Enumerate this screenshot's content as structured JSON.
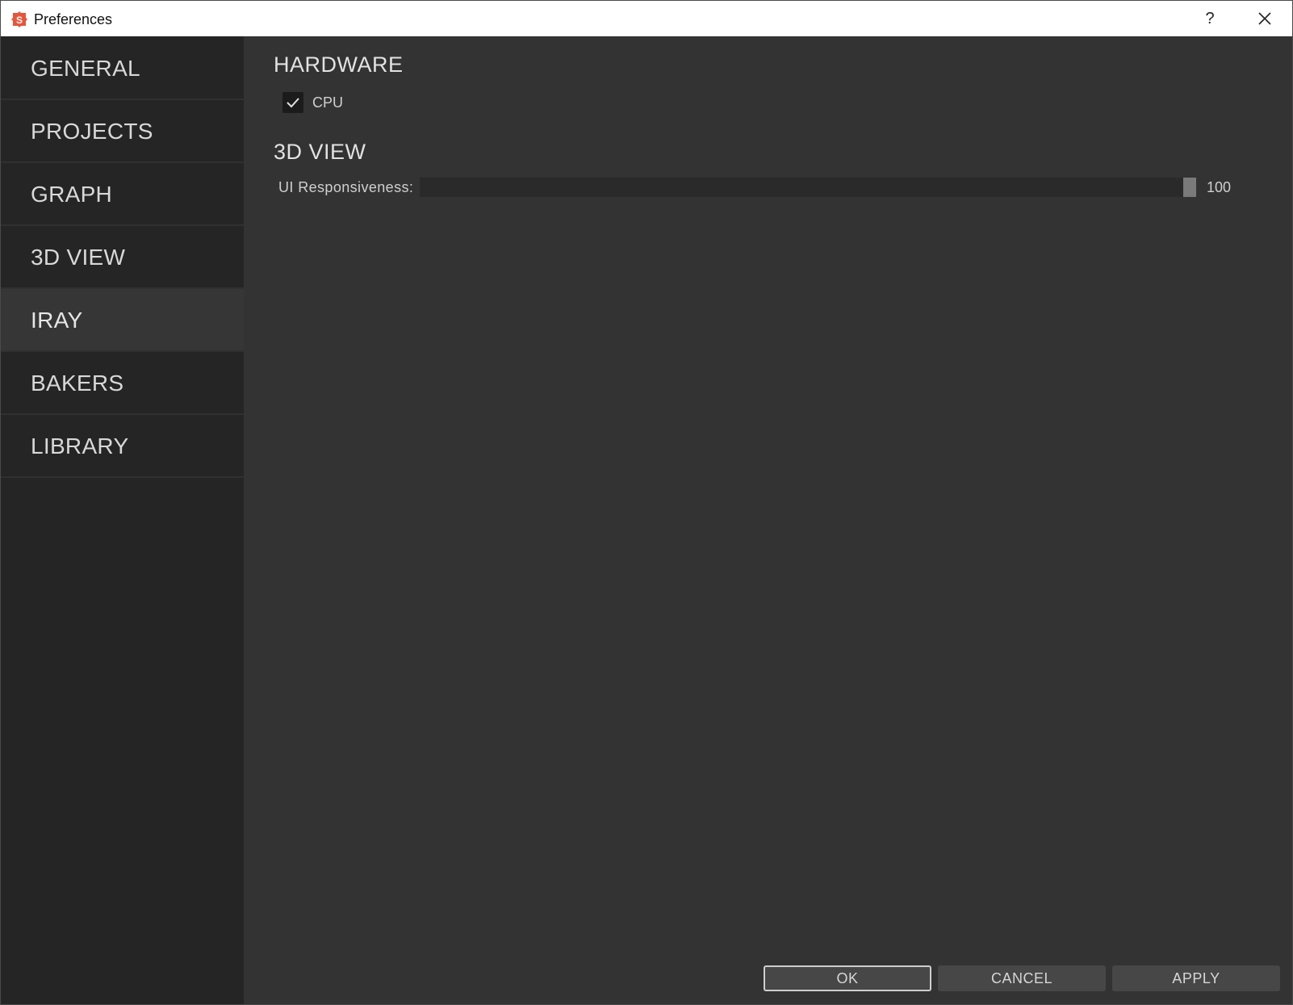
{
  "window": {
    "title": "Preferences",
    "help_label": "?"
  },
  "sidebar": {
    "items": [
      {
        "label": "GENERAL",
        "active": false
      },
      {
        "label": "PROJECTS",
        "active": false
      },
      {
        "label": "GRAPH",
        "active": false
      },
      {
        "label": "3D VIEW",
        "active": false
      },
      {
        "label": "IRAY",
        "active": true
      },
      {
        "label": "BAKERS",
        "active": false
      },
      {
        "label": "LIBRARY",
        "active": false
      }
    ]
  },
  "main": {
    "hardware": {
      "title": "HARDWARE",
      "cpu_label": "CPU",
      "cpu_checked": true
    },
    "view3d": {
      "title": "3D VIEW",
      "responsiveness_label": "UI Responsiveness:",
      "responsiveness_value": "100",
      "responsiveness_fraction": 1.0
    }
  },
  "buttons": {
    "ok": "OK",
    "cancel": "CANCEL",
    "apply": "APPLY"
  },
  "colors": {
    "app_icon": "#e8543a",
    "accent_handle": "#7a7a7a"
  },
  "icons": {
    "app": "substance-logo-icon",
    "close": "close-icon",
    "check": "checkmark-icon"
  }
}
